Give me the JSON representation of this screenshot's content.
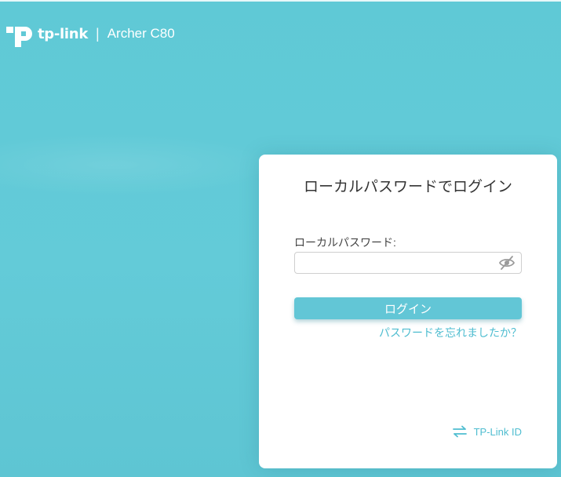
{
  "header": {
    "brand": "tp-link",
    "separator": "|",
    "model": "Archer C80"
  },
  "login": {
    "title": "ローカルパスワードでログイン",
    "password_label": "ローカルパスワード:",
    "password_value": "",
    "login_button": "ログイン",
    "forgot_link": "パスワードを忘れましたか？",
    "tplink_id": "TP-Link ID"
  },
  "icons": {
    "logo": "tp-link-logo-icon",
    "password_toggle": "eye-off-icon",
    "tplink_id": "swap-arrows-icon"
  },
  "colors": {
    "background": "#61c9d6",
    "accent": "#62c6d6",
    "link": "#4fbdd0",
    "card": "#ffffff"
  }
}
